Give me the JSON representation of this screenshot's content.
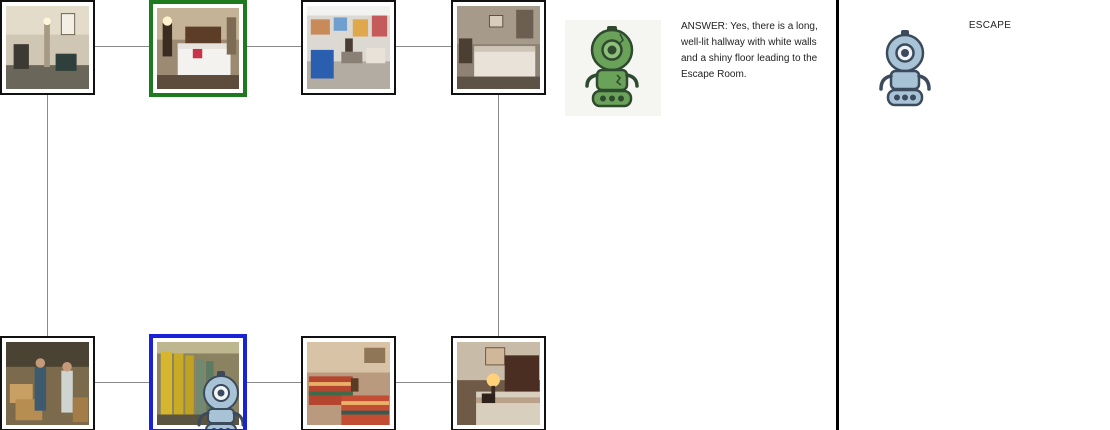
{
  "answer": {
    "text": "ANSWER: Yes, there is a long, well-lit hallway with white walls and a shiny floor leading to the Escape Room."
  },
  "escape": {
    "label": "ESCAPE"
  },
  "graph": {
    "nodes": [
      {
        "id": "r0",
        "scene": "hallway-with-chairs",
        "state": "normal"
      },
      {
        "id": "r1",
        "scene": "hotel-bedroom",
        "state": "goal"
      },
      {
        "id": "r2",
        "scene": "classroom",
        "state": "normal"
      },
      {
        "id": "r3",
        "scene": "bedroom-dim",
        "state": "normal"
      },
      {
        "id": "r4",
        "scene": "storage-room-boxes",
        "state": "normal"
      },
      {
        "id": "r5",
        "scene": "locker-room",
        "state": "current"
      },
      {
        "id": "r6",
        "scene": "twin-bedroom",
        "state": "normal"
      },
      {
        "id": "r7",
        "scene": "bedroom-lamp",
        "state": "normal"
      }
    ]
  },
  "colors": {
    "goal_border": "#1e7a1e",
    "current_border": "#1a22d8",
    "edge": "#8a8a8a",
    "answer_robot": "#5e9a4e",
    "escape_robot": "#a9c3d6"
  },
  "icons": {
    "answer_robot": "green-robot-icon",
    "escape_robot": "blue-robot-icon",
    "agent_marker": "blue-robot-icon"
  }
}
